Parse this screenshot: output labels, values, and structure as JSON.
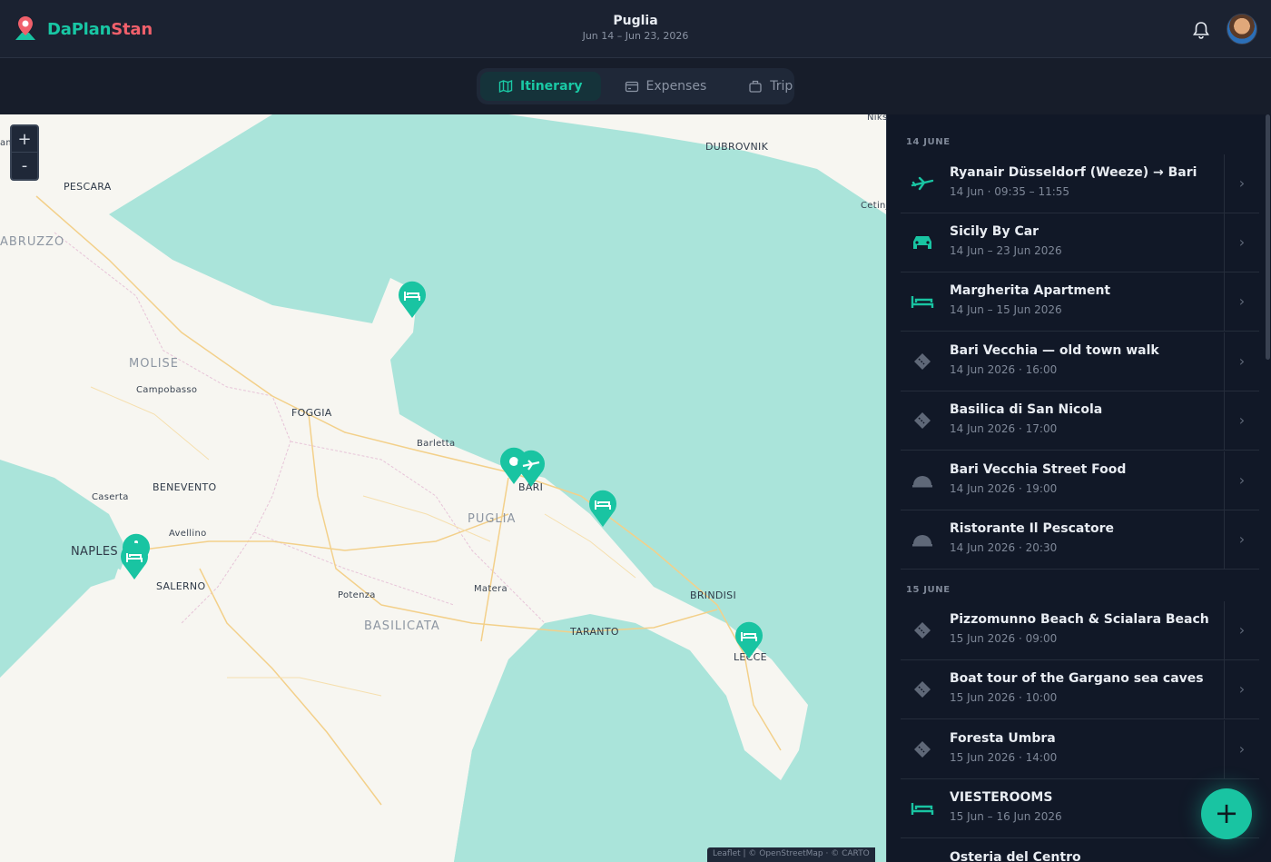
{
  "app": {
    "name_part1": "DaPlan",
    "name_part2": "Stan"
  },
  "trip": {
    "title": "Puglia",
    "dates": "Jun 14 – Jun 23, 2026"
  },
  "tabs": [
    {
      "label": "Itinerary",
      "icon": "map-icon",
      "active": true
    },
    {
      "label": "Expenses",
      "icon": "wallet-icon",
      "active": false
    },
    {
      "label": "Trip",
      "icon": "suitcase-icon",
      "active": false
    }
  ],
  "map": {
    "zoom_in": "+",
    "zoom_out": "-",
    "attribution": "Leaflet | © OpenStreetMap · © CARTO",
    "labels": {
      "pescara": "PESCARA",
      "abruzzo": "ABRUZZO",
      "molise": "MOLISE",
      "campobasso": "Campobasso",
      "foggia": "FOGGIA",
      "barletta": "Barletta",
      "bari": "BARI",
      "benevento": "BENEVENTO",
      "caserta": "Caserta",
      "avellino": "Avellino",
      "naples": "NAPLES",
      "salerno": "SALERNO",
      "puglia": "PUGLIA",
      "potenza": "Potenza",
      "matera": "Matera",
      "basilicata": "BASILICATA",
      "taranto": "TARANTO",
      "brindisi": "BRINDISI",
      "lecce": "LECCE",
      "dubrovnik": "DUBROVNIK",
      "niks": "Niks",
      "cetin": "Cetinj",
      "am": "am"
    }
  },
  "itinerary": {
    "days": [
      {
        "label": "14 JUNE",
        "items": [
          {
            "icon": "plane-icon",
            "title": "Ryanair Düsseldorf (Weeze) → Bari",
            "subtitle": "14 Jun · 09:35 – 11:55"
          },
          {
            "icon": "car-icon",
            "title": "Sicily By Car",
            "subtitle": "14 Jun – 23 Jun 2026"
          },
          {
            "icon": "bed-icon",
            "title": "Margherita Apartment",
            "subtitle": "14 Jun – 15 Jun 2026"
          },
          {
            "icon": "ticket-icon",
            "title": "Bari Vecchia — old town walk",
            "subtitle": "14 Jun 2026 · 16:00"
          },
          {
            "icon": "ticket-icon",
            "title": "Basilica di San Nicola",
            "subtitle": "14 Jun 2026 · 17:00"
          },
          {
            "icon": "cloche-icon",
            "title": "Bari Vecchia Street Food",
            "subtitle": "14 Jun 2026 · 19:00"
          },
          {
            "icon": "cloche-icon",
            "title": "Ristorante Il Pescatore",
            "subtitle": "14 Jun 2026 · 20:30"
          }
        ]
      },
      {
        "label": "15 JUNE",
        "items": [
          {
            "icon": "ticket-icon",
            "title": "Pizzomunno Beach & Scialara Beach",
            "subtitle": "15 Jun 2026 · 09:00"
          },
          {
            "icon": "ticket-icon",
            "title": "Boat tour of the Gargano sea caves",
            "subtitle": "15 Jun 2026 · 10:00"
          },
          {
            "icon": "ticket-icon",
            "title": "Foresta Umbra",
            "subtitle": "15 Jun 2026 · 14:00"
          },
          {
            "icon": "bed-icon",
            "title": "VIESTEROOMS",
            "subtitle": "15 Jun – 16 Jun 2026"
          },
          {
            "icon": "cloche-icon",
            "title": "Osteria del Centro",
            "subtitle": ""
          }
        ]
      }
    ]
  },
  "fab": {
    "label": "+"
  },
  "colors": {
    "accent": "#19c4a2",
    "brand_red": "#f0606b",
    "sidebar_bg": "#111827",
    "header_bg": "#1b2231"
  }
}
